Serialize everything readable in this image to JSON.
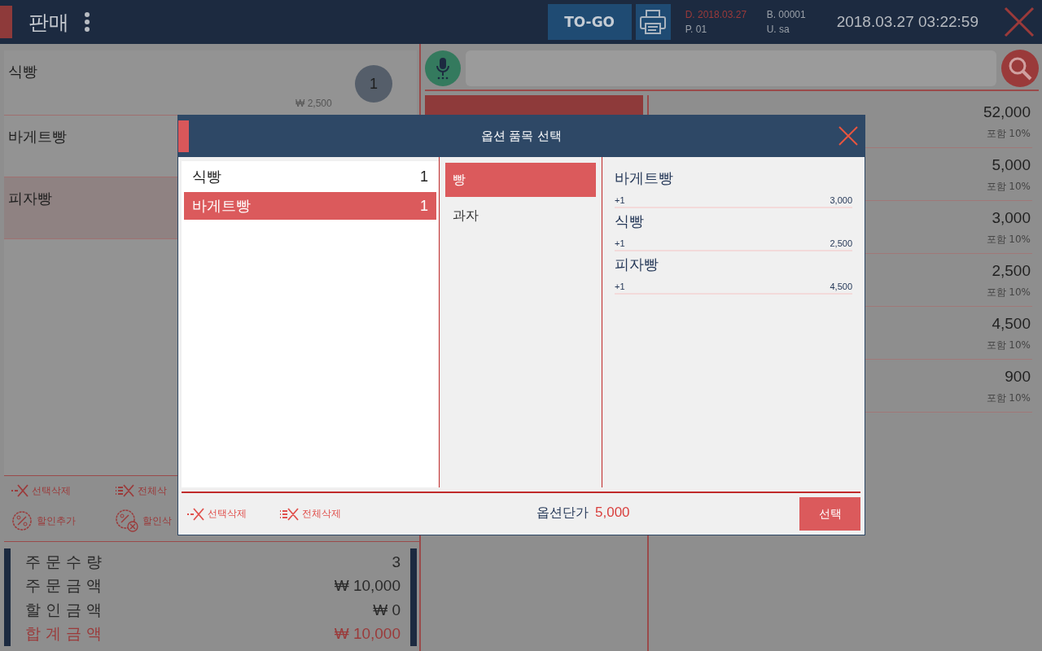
{
  "header": {
    "title": "판매",
    "togo": "TO-GO",
    "date": "D. 2018.03.27",
    "pos": "P. 01",
    "bill": "B. 00001",
    "user": "U. sa",
    "clock": "2018.03.27 03:22:59"
  },
  "order_items": [
    {
      "name": "식빵",
      "qty": "1",
      "price": "₩ 2,500",
      "selected": false
    },
    {
      "name": "바게트빵",
      "selected": false
    },
    {
      "name": "피자빵",
      "selected": true
    }
  ],
  "order_actions": [
    {
      "kind": "delete-selected",
      "label": "선택삭제"
    },
    {
      "kind": "delete-all",
      "label": "전체삭"
    },
    {
      "kind": "discount-add",
      "label": "할인추가"
    },
    {
      "kind": "discount-remove",
      "label": "할인삭"
    }
  ],
  "summary": [
    {
      "label": "주 문 수 량",
      "value": "3",
      "total": false
    },
    {
      "label": "주 문 금 액",
      "value": "₩ 10,000",
      "total": false
    },
    {
      "label": "할 인 금 액",
      "value": "₩ 0",
      "total": false
    },
    {
      "label": "합 계 금 액",
      "value": "₩ 10,000",
      "total": true
    }
  ],
  "products": [
    {
      "price": "52,000",
      "tax": "포함 10%"
    },
    {
      "price": "5,000",
      "tax": "포함 10%"
    },
    {
      "price": "3,000",
      "tax": "포함 10%"
    },
    {
      "price": "2,500",
      "tax": "포함 10%"
    },
    {
      "price": "4,500",
      "tax": "포함 10%"
    },
    {
      "price": "900",
      "tax": "포함 10%"
    }
  ],
  "dialog": {
    "title": "옵션 품목 선택",
    "items": [
      {
        "name": "식빵",
        "qty": "1",
        "selected": false
      },
      {
        "name": "바게트빵",
        "qty": "1",
        "selected": true
      }
    ],
    "categories": [
      {
        "label": "빵",
        "selected": true
      },
      {
        "label": "과자",
        "selected": false
      }
    ],
    "options": [
      {
        "name": "바게트빵",
        "qty": "+1",
        "price": "3,000"
      },
      {
        "name": "식빵",
        "qty": "+1",
        "price": "2,500"
      },
      {
        "name": "피자빵",
        "qty": "+1",
        "price": "4,500"
      }
    ],
    "actions": [
      {
        "kind": "delete-selected",
        "label": "선택삭제"
      },
      {
        "kind": "delete-all",
        "label": "전체삭제"
      }
    ],
    "unit_label": "옵션단가",
    "unit_price": "5,000",
    "confirm": "선택"
  }
}
